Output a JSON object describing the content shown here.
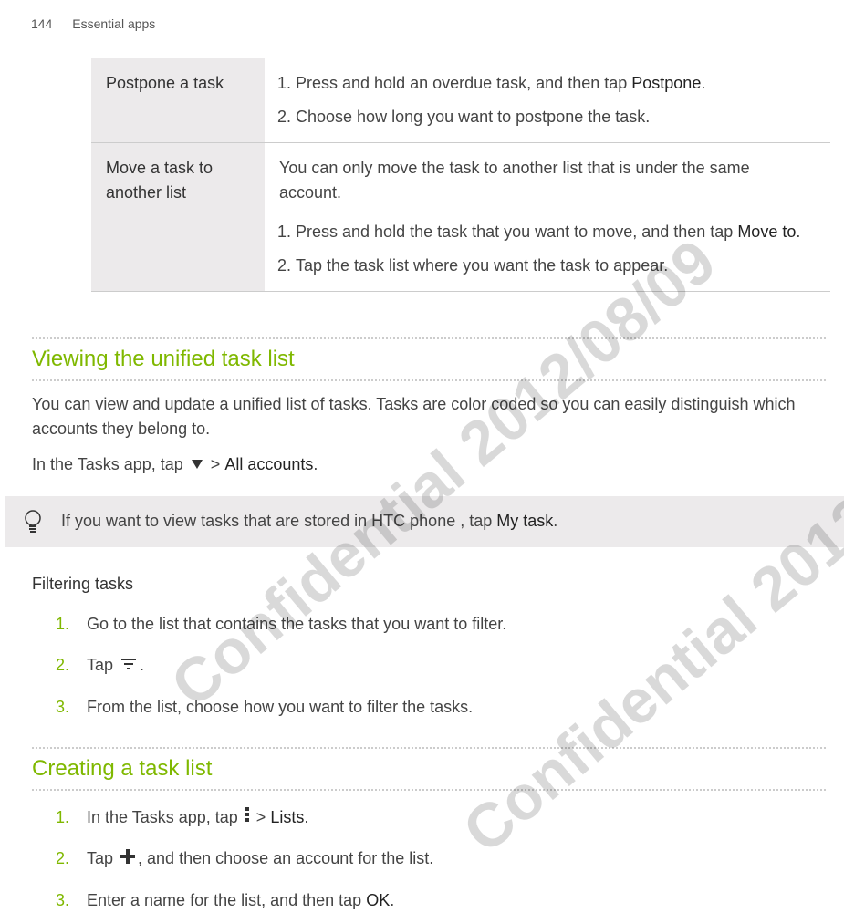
{
  "header": {
    "page_number": "144",
    "chapter": "Essential apps"
  },
  "watermark": "Confidential  2012/08/09",
  "table": {
    "row1": {
      "label": "Postpone a task",
      "step1_prefix": "Press and hold an overdue task, and then tap ",
      "step1_bold": "Postpone",
      "step1_suffix": ".",
      "step2": "Choose how long you want to postpone the task."
    },
    "row2": {
      "label": "Move a task to another list",
      "intro": "You can only move the task to another list that is under the same account.",
      "step1_prefix": "Press and hold the task that you want to move, and then tap ",
      "step1_bold": "Move to",
      "step1_suffix": ".",
      "step2": "Tap the task list where you want the task to appear."
    }
  },
  "section1": {
    "title": "Viewing the unified task list",
    "para1": "You can view and update a unified list of tasks. Tasks are color coded so you can easily distinguish which accounts they belong to.",
    "para2_prefix": "In the Tasks app, tap ",
    "para2_mid": " > ",
    "para2_bold": "All accounts",
    "para2_suffix": ".",
    "tip_prefix": "If you want to view tasks that are stored in HTC phone , tap ",
    "tip_bold": "My task",
    "tip_suffix": "."
  },
  "filtering": {
    "heading": "Filtering tasks",
    "step1": "Go to the list that contains the tasks that you want to filter.",
    "step2_prefix": "Tap ",
    "step2_suffix": ".",
    "step3": "From the list, choose how you want to filter the tasks."
  },
  "section2": {
    "title": "Creating a task list",
    "step1_prefix": "In the Tasks app, tap ",
    "step1_mid": " > ",
    "step1_bold": "Lists",
    "step1_suffix": ".",
    "step2_prefix": "Tap ",
    "step2_suffix": ", and then choose an account for the list.",
    "step3_prefix": "Enter a name for the list, and then tap ",
    "step3_bold": "OK",
    "step3_suffix": "."
  },
  "numbers": {
    "n1": "1.",
    "n2": "2.",
    "n3": "3."
  }
}
